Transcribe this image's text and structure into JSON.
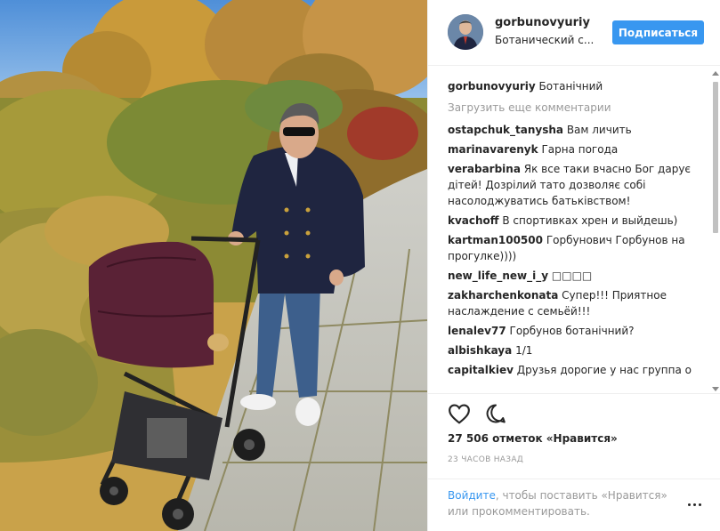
{
  "post": {
    "username": "gorbunovyuriy",
    "location": "Ботанический с...",
    "follow_label": "Подписаться",
    "caption_user": "gorbunovyuriy",
    "caption_text": "Ботанічний",
    "load_more": "Загрузить еще комментарии",
    "likes": "27 506 отметок «Нравится»",
    "timestamp": "23 ЧАСОВ НАЗАД"
  },
  "comments": [
    {
      "user": "ostapchuk_tanysha",
      "text": "Вам личить"
    },
    {
      "user": "marinavarenyk",
      "text": "Гарна погода"
    },
    {
      "user": "verabarbina",
      "text": "Як все таки вчасно Бог дарує дітей! Дозрілий тато дозволяє собі насолоджуватись батьківством!"
    },
    {
      "user": "kvachoff",
      "text": "В спортивках хрен и выйдешь)"
    },
    {
      "user": "kartman100500",
      "text": "Горбунович Горбунов на прогулке))))"
    },
    {
      "user": "new_life_new_i_y",
      "text": "□□□□"
    },
    {
      "user": "zakharchenkonata",
      "text": "Супер!!! Приятное наслаждение с семьёй!!!"
    },
    {
      "user": "lenalev77",
      "text": "Горбунов ботанічний?"
    },
    {
      "user": "albishkaya",
      "text": "1/1"
    },
    {
      "user": "capitalkiev",
      "text": "Друзья дорогие у нас группа о"
    }
  ],
  "footer": {
    "login_link": "Войдите",
    "rest": ", чтобы поставить «Нравится» или прокомментировать."
  },
  "icons": {
    "like": "heart-icon",
    "comment": "comment-icon",
    "more": "more-options-icon"
  },
  "colors": {
    "accent": "#3897f0",
    "muted": "#999999",
    "text": "#262626",
    "border": "#efefef"
  }
}
